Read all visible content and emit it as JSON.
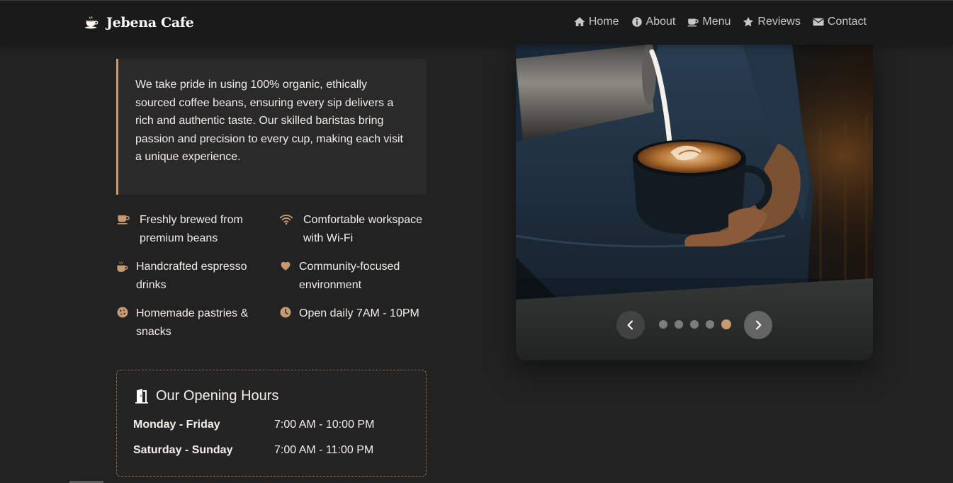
{
  "brand": {
    "name": "Jebena Cafe",
    "icon": "coffee-cup-icon"
  },
  "nav": [
    {
      "label": "Home",
      "icon": "home-icon"
    },
    {
      "label": "About",
      "icon": "info-icon"
    },
    {
      "label": "Menu",
      "icon": "coffee-mug-icon"
    },
    {
      "label": "Reviews",
      "icon": "star-icon"
    },
    {
      "label": "Contact",
      "icon": "envelope-icon"
    }
  ],
  "about": {
    "quote": "We take pride in using 100% organic, ethically sourced coffee beans, ensuring every sip delivers a rich and authentic taste. Our skilled baristas bring passion and precision to every cup, making each visit a unique experience."
  },
  "features": [
    {
      "text": "Freshly brewed from premium beans",
      "icon": "coffee-mug-icon"
    },
    {
      "text": "Comfortable workspace with Wi-Fi",
      "icon": "wifi-icon"
    },
    {
      "text": "Handcrafted espresso drinks",
      "icon": "hot-cup-icon"
    },
    {
      "text": "Community-focused environment",
      "icon": "heart-icon"
    },
    {
      "text": "Homemade pastries & snacks",
      "icon": "cookie-icon"
    },
    {
      "text": "Open daily 7AM - 10PM",
      "icon": "clock-icon"
    }
  ],
  "hours": {
    "title": "Our Opening Hours",
    "icon": "door-open-icon",
    "rows": [
      {
        "day": "Monday - Friday",
        "time": "7:00 AM - 10:00 PM"
      },
      {
        "day": "Saturday - Sunday",
        "time": "7:00 AM - 11:00 PM"
      }
    ]
  },
  "slider": {
    "slide_count": 5,
    "active_index": 4
  },
  "colors": {
    "background": "#222222",
    "navbar": "#1a1a1a",
    "accent": "#c89a72",
    "text": "#f2ede8"
  }
}
